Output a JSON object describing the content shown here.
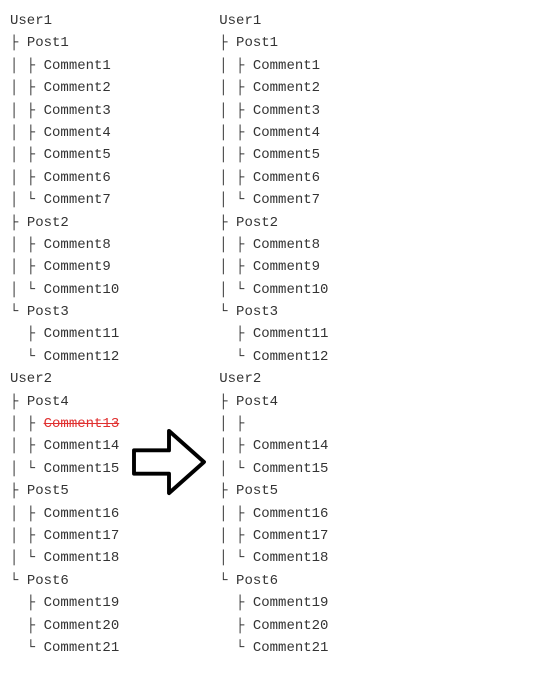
{
  "left_tree": {
    "nodes": [
      {
        "prefix": "",
        "label": "User1",
        "struck": false
      },
      {
        "prefix": "├ ",
        "label": "Post1",
        "struck": false
      },
      {
        "prefix": "│ ├ ",
        "label": "Comment1",
        "struck": false
      },
      {
        "prefix": "│ ├ ",
        "label": "Comment2",
        "struck": false
      },
      {
        "prefix": "│ ├ ",
        "label": "Comment3",
        "struck": false
      },
      {
        "prefix": "│ ├ ",
        "label": "Comment4",
        "struck": false
      },
      {
        "prefix": "│ ├ ",
        "label": "Comment5",
        "struck": false
      },
      {
        "prefix": "│ ├ ",
        "label": "Comment6",
        "struck": false
      },
      {
        "prefix": "│ └ ",
        "label": "Comment7",
        "struck": false
      },
      {
        "prefix": "├ ",
        "label": "Post2",
        "struck": false
      },
      {
        "prefix": "│ ├ ",
        "label": "Comment8",
        "struck": false
      },
      {
        "prefix": "│ ├ ",
        "label": "Comment9",
        "struck": false
      },
      {
        "prefix": "│ └ ",
        "label": "Comment10",
        "struck": false
      },
      {
        "prefix": "└ ",
        "label": "Post3",
        "struck": false
      },
      {
        "prefix": "  ├ ",
        "label": "Comment11",
        "struck": false
      },
      {
        "prefix": "  └ ",
        "label": "Comment12",
        "struck": false
      },
      {
        "prefix": "",
        "label": "User2",
        "struck": false
      },
      {
        "prefix": "├ ",
        "label": "Post4",
        "struck": false
      },
      {
        "prefix": "│ ├ ",
        "label": "Comment13",
        "struck": true
      },
      {
        "prefix": "│ ├ ",
        "label": "Comment14",
        "struck": false
      },
      {
        "prefix": "│ └ ",
        "label": "Comment15",
        "struck": false
      },
      {
        "prefix": "├ ",
        "label": "Post5",
        "struck": false
      },
      {
        "prefix": "│ ├ ",
        "label": "Comment16",
        "struck": false
      },
      {
        "prefix": "│ ├ ",
        "label": "Comment17",
        "struck": false
      },
      {
        "prefix": "│ └ ",
        "label": "Comment18",
        "struck": false
      },
      {
        "prefix": "└ ",
        "label": "Post6",
        "struck": false
      },
      {
        "prefix": "  ├ ",
        "label": "Comment19",
        "struck": false
      },
      {
        "prefix": "  ├ ",
        "label": "Comment20",
        "struck": false
      },
      {
        "prefix": "  └ ",
        "label": "Comment21",
        "struck": false
      }
    ]
  },
  "right_tree": {
    "nodes": [
      {
        "prefix": "",
        "label": "User1",
        "struck": false
      },
      {
        "prefix": "├ ",
        "label": "Post1",
        "struck": false
      },
      {
        "prefix": "│ ├ ",
        "label": "Comment1",
        "struck": false
      },
      {
        "prefix": "│ ├ ",
        "label": "Comment2",
        "struck": false
      },
      {
        "prefix": "│ ├ ",
        "label": "Comment3",
        "struck": false
      },
      {
        "prefix": "│ ├ ",
        "label": "Comment4",
        "struck": false
      },
      {
        "prefix": "│ ├ ",
        "label": "Comment5",
        "struck": false
      },
      {
        "prefix": "│ ├ ",
        "label": "Comment6",
        "struck": false
      },
      {
        "prefix": "│ └ ",
        "label": "Comment7",
        "struck": false
      },
      {
        "prefix": "├ ",
        "label": "Post2",
        "struck": false
      },
      {
        "prefix": "│ ├ ",
        "label": "Comment8",
        "struck": false
      },
      {
        "prefix": "│ ├ ",
        "label": "Comment9",
        "struck": false
      },
      {
        "prefix": "│ └ ",
        "label": "Comment10",
        "struck": false
      },
      {
        "prefix": "└ ",
        "label": "Post3",
        "struck": false
      },
      {
        "prefix": "  ├ ",
        "label": "Comment11",
        "struck": false
      },
      {
        "prefix": "  └ ",
        "label": "Comment12",
        "struck": false
      },
      {
        "prefix": "",
        "label": "User2",
        "struck": false
      },
      {
        "prefix": "├ ",
        "label": "Post4",
        "struck": false
      },
      {
        "prefix": "│ ├ ",
        "label": "",
        "struck": false
      },
      {
        "prefix": "│ ├ ",
        "label": "Comment14",
        "struck": false
      },
      {
        "prefix": "│ └ ",
        "label": "Comment15",
        "struck": false
      },
      {
        "prefix": "├ ",
        "label": "Post5",
        "struck": false
      },
      {
        "prefix": "│ ├ ",
        "label": "Comment16",
        "struck": false
      },
      {
        "prefix": "│ ├ ",
        "label": "Comment17",
        "struck": false
      },
      {
        "prefix": "│ └ ",
        "label": "Comment18",
        "struck": false
      },
      {
        "prefix": "└ ",
        "label": "Post6",
        "struck": false
      },
      {
        "prefix": "  ├ ",
        "label": "Comment19",
        "struck": false
      },
      {
        "prefix": "  ├ ",
        "label": "Comment20",
        "struck": false
      },
      {
        "prefix": "  └ ",
        "label": "Comment21",
        "struck": false
      }
    ]
  }
}
